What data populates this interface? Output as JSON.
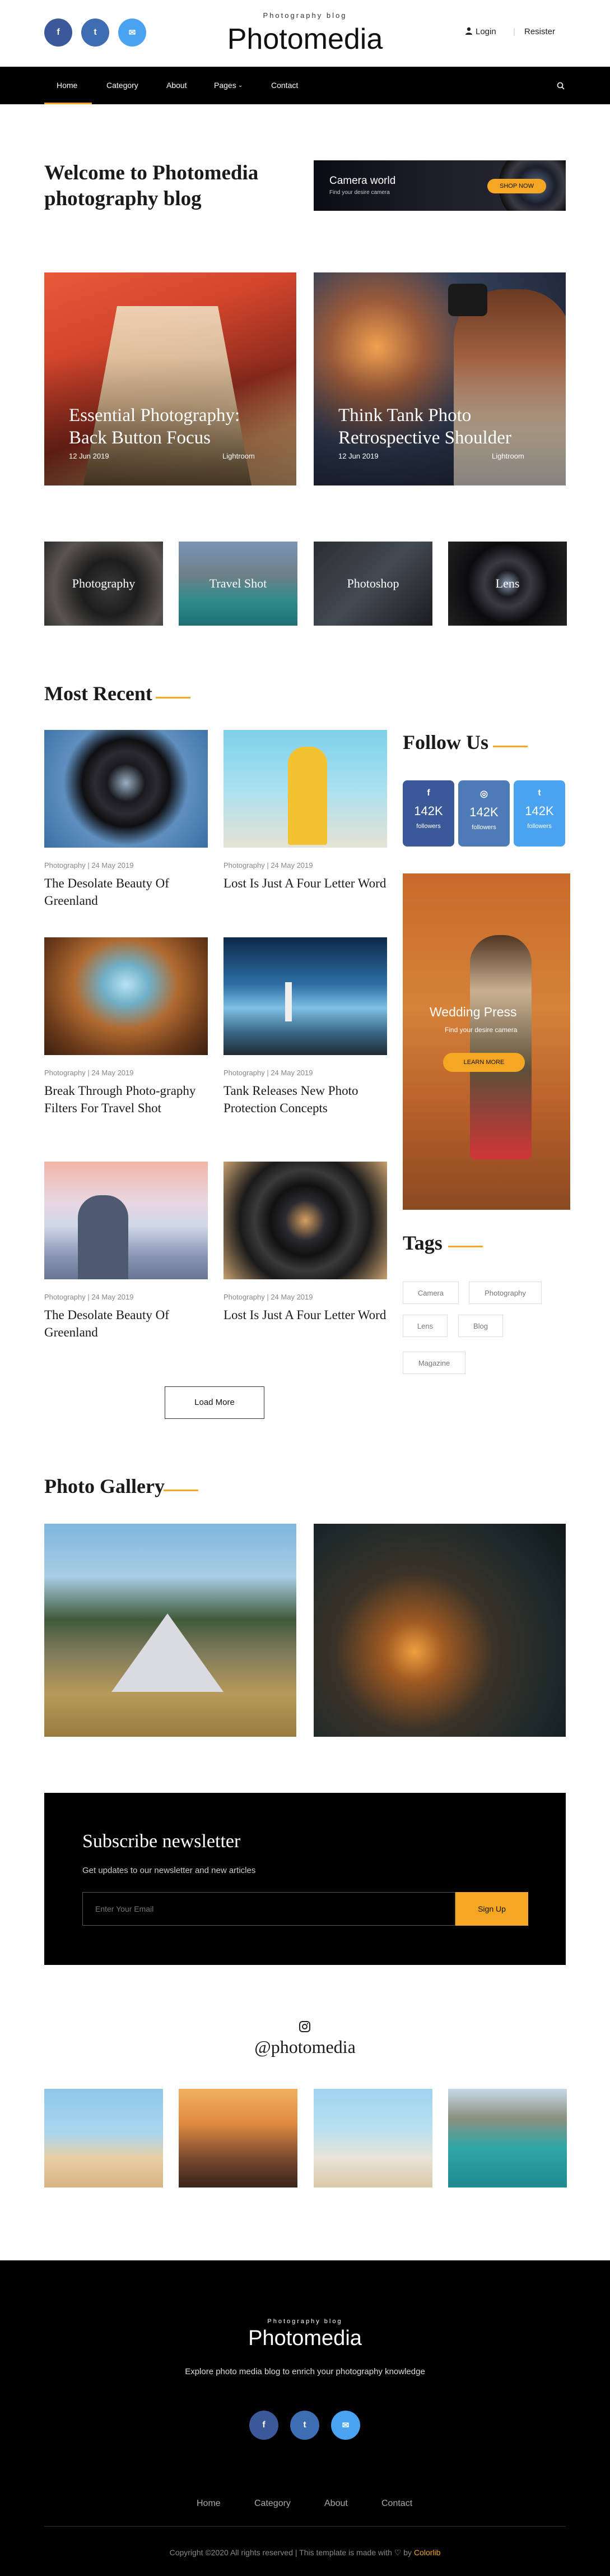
{
  "header": {
    "social": [
      {
        "icon": "facebook-icon",
        "glyph": "f",
        "color": "#3b5998"
      },
      {
        "icon": "twitter-icon",
        "glyph": "t",
        "color": "#3f6db1"
      },
      {
        "icon": "email-icon",
        "glyph": "✉",
        "color": "#4aa3f0"
      }
    ],
    "tagline": "Photography blog",
    "brand": "Photomedia",
    "login": "Login",
    "register": "Resister"
  },
  "nav": {
    "items": [
      "Home",
      "Category",
      "About",
      "Pages",
      "Contact"
    ],
    "active": "Home",
    "accent": "#f5a623"
  },
  "welcome": {
    "title": "Welcome to Photomedia photography blog",
    "banner_title": "Camera world",
    "banner_sub": "Find your desire camera",
    "banner_button": "SHOP NOW"
  },
  "features": [
    {
      "title": "Essential Photography: Back Button Focus",
      "date": "12 Jun 2019",
      "category": "Lightroom"
    },
    {
      "title": "Think Tank Photo Retrospective Shoulder",
      "date": "12 Jun 2019",
      "category": "Lightroom"
    }
  ],
  "categories": [
    "Photography",
    "Travel Shot",
    "Photoshop",
    "Lens"
  ],
  "most_recent": {
    "title": "Most Recent",
    "posts": [
      {
        "meta": "Photography | 24 May 2019",
        "title": "The Desolate Beauty Of Greenland"
      },
      {
        "meta": "Photography | 24 May 2019",
        "title": "Lost Is Just A Four Letter Word"
      },
      {
        "meta": "Photography | 24 May 2019",
        "title": "Break Through Photo-graphy Filters For Travel Shot"
      },
      {
        "meta": "Photography | 24 May 2019",
        "title": "Tank Releases New Photo Protection Concepts"
      },
      {
        "meta": "Photography | 24 May 2019",
        "title": "The Desolate Beauty Of Greenland"
      },
      {
        "meta": "Photography | 24 May 2019",
        "title": "Lost Is Just A Four Letter Word"
      }
    ],
    "load_more": "Load More"
  },
  "sidebar": {
    "follow_title": "Follow Us",
    "follow": [
      {
        "icon": "facebook-icon",
        "glyph": "f",
        "count": "142K",
        "label": "followers",
        "color": "#3b5998"
      },
      {
        "icon": "instagram-icon",
        "glyph": "◎",
        "count": "142K",
        "label": "followers",
        "color": "#4e7bb5"
      },
      {
        "icon": "twitter-icon",
        "glyph": "t",
        "count": "142K",
        "label": "followers",
        "color": "#4aa3f0"
      }
    ],
    "promo_title": "Wedding Press",
    "promo_sub": "Find your desire camera",
    "promo_button": "LEARN MORE",
    "tags_title": "Tags",
    "tags": [
      "Camera",
      "Photography",
      "Lens",
      "Blog",
      "Magazine"
    ]
  },
  "gallery": {
    "title": "Photo Gallery"
  },
  "subscribe": {
    "title": "Subscribe newsletter",
    "subtitle": "Get updates to our newsletter and new articles",
    "placeholder": "Enter Your Email",
    "button": "Sign Up"
  },
  "instagram": {
    "handle": "@photomedia"
  },
  "footer": {
    "tagline": "Photography blog",
    "brand": "Photomedia",
    "description": "Explore photo media blog to enrich your photography knowledge",
    "links": [
      "Home",
      "Category",
      "About",
      "Contact"
    ],
    "copyright": "Copyright ©2020 All rights reserved | This template is made with",
    "by": "by",
    "author": "Colorlib"
  }
}
